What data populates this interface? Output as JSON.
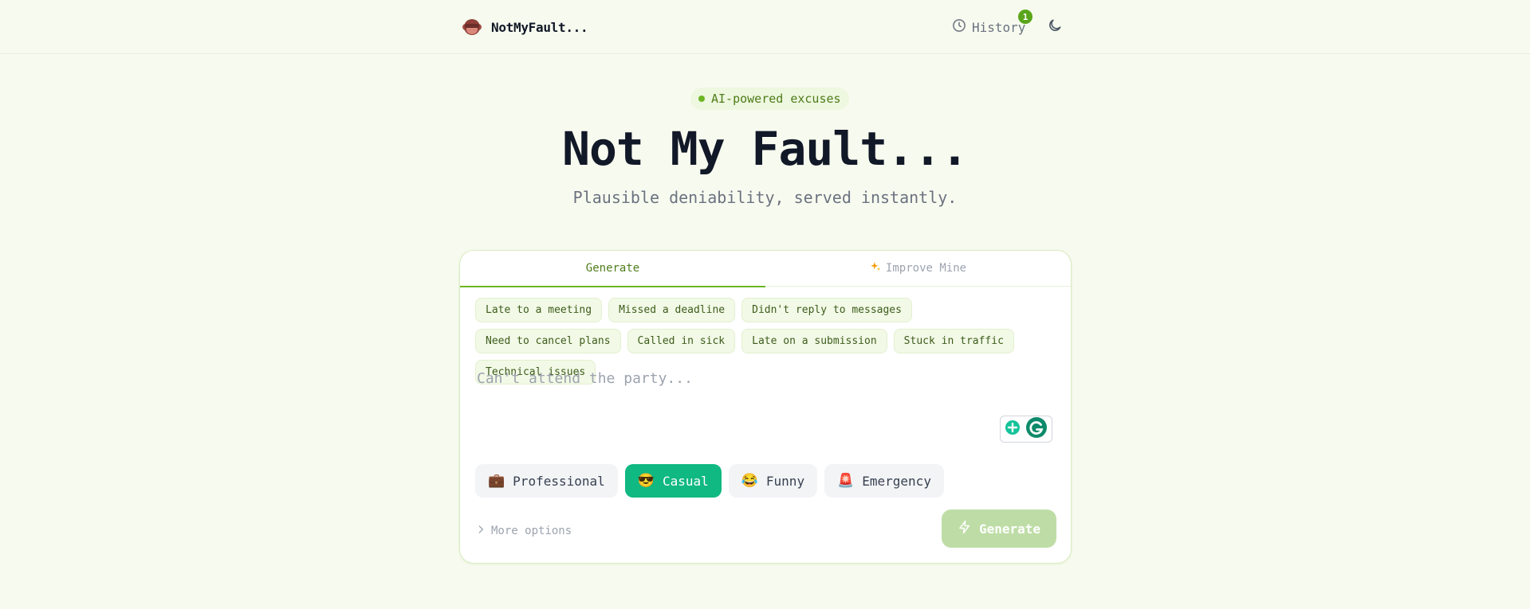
{
  "header": {
    "brand_name": "NotMyFault...",
    "history_label": "History",
    "history_count": "1"
  },
  "hero": {
    "badge": "AI-powered excuses",
    "title": "Not My Fault...",
    "subtitle": "Plausible deniability, served instantly."
  },
  "tabs": [
    {
      "label": "Generate",
      "active": true
    },
    {
      "label": "Improve Mine",
      "icon": "sparkles-icon",
      "active": false
    }
  ],
  "chips": [
    "Late to a meeting",
    "Missed a deadline",
    "Didn't reply to messages",
    "Need to cancel plans",
    "Called in sick",
    "Late on a submission",
    "Stuck in traffic",
    "Technical issues"
  ],
  "input": {
    "placeholder": "Can't attend the party...",
    "value": ""
  },
  "tones": [
    {
      "label": "Professional",
      "emoji": "💼",
      "active": false
    },
    {
      "label": "Casual",
      "emoji": "😎",
      "active": true
    },
    {
      "label": "Funny",
      "emoji": "😂",
      "active": false
    },
    {
      "label": "Emergency",
      "emoji": "🚨",
      "active": false
    }
  ],
  "footer": {
    "more_options": "More options",
    "generate_label": "Generate"
  },
  "colors": {
    "accent_green": "#6bb624",
    "tone_active": "#10b981",
    "generate_disabled": "#bedda6",
    "page_bg": "#f7fbef"
  }
}
